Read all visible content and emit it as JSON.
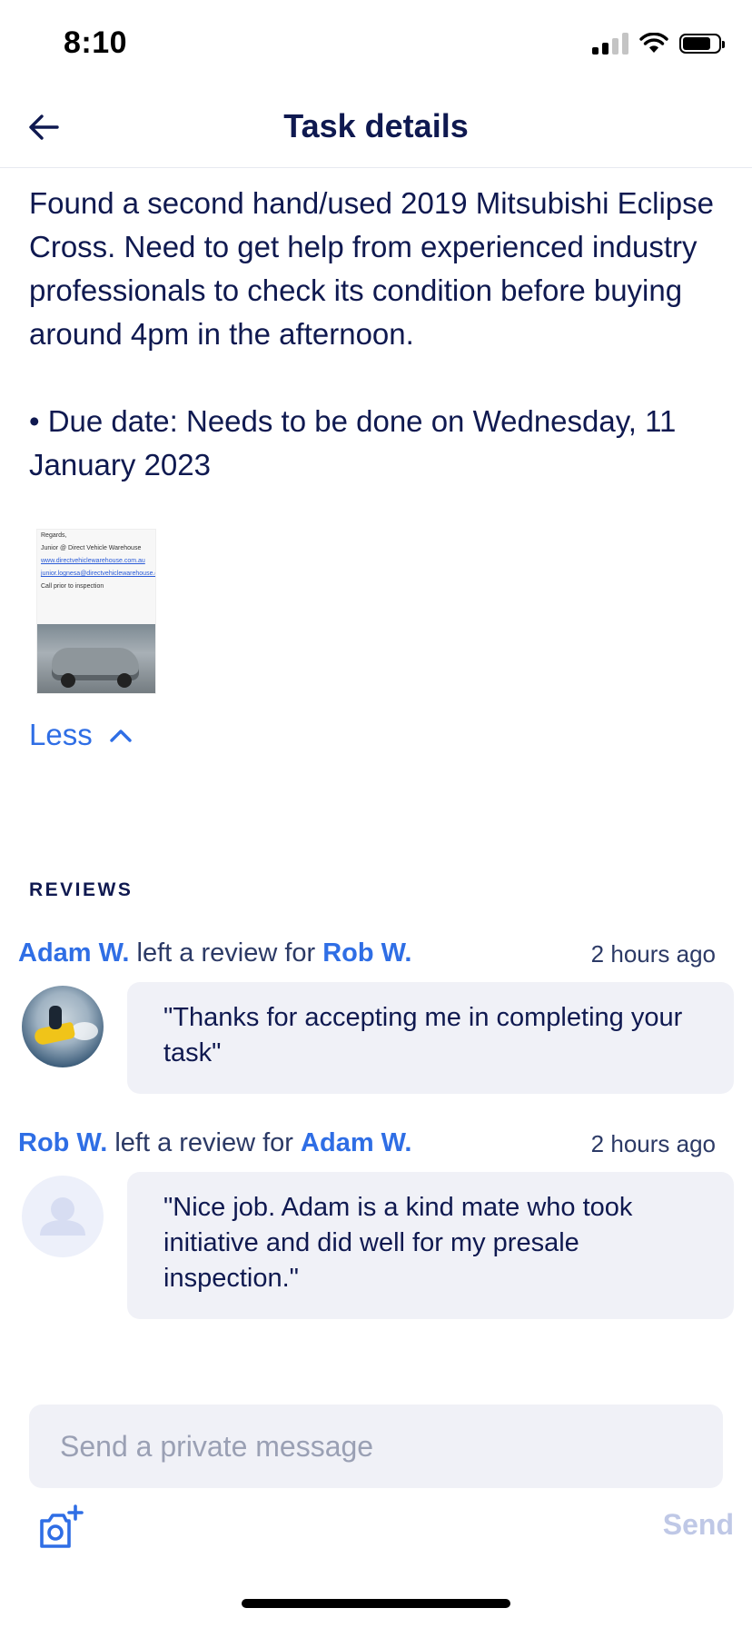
{
  "status_bar": {
    "time": "8:10"
  },
  "nav": {
    "title": "Task details",
    "back_icon": "arrow-left-icon"
  },
  "task": {
    "description": "Found a second hand/used 2019 Mitsubishi Eclipse Cross. Need to get help from experienced industry professionals to check its condition before buying around 4pm in the afternoon.",
    "due": "• Due date: Needs to be done on Wednesday, 11 January 2023",
    "attachment": {
      "line1": "Regards,",
      "line2": "Junior @ Direct Vehicle Warehouse",
      "link1": "www.directvehiclewarehouse.com.au",
      "link2": "junior.lognesa@directvehiclewarehouse.com.au",
      "line3": "Call prior to inspection"
    },
    "toggle_label": "Less"
  },
  "reviews": {
    "heading": "REVIEWS",
    "connector": "left a review for",
    "items": [
      {
        "author": "Adam W.",
        "target": "Rob W.",
        "time": "2 hours ago",
        "text": "\"Thanks for accepting me in completing your task\""
      },
      {
        "author": "Rob W.",
        "target": "Adam W.",
        "time": "2 hours ago",
        "text": "\"Nice job. Adam is a kind mate who took initiative and did well for my presale inspection.\""
      }
    ]
  },
  "composer": {
    "placeholder": "Send a private message",
    "send_label": "Send",
    "camera_icon": "camera-add-icon"
  },
  "colors": {
    "primary": "#2f6ee5",
    "text": "#0f1950",
    "bubble": "#f0f1f7",
    "send_disabled": "#bfc8e6"
  }
}
